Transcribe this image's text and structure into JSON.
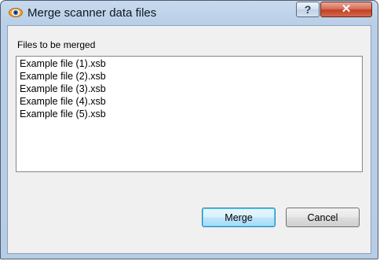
{
  "window": {
    "title": "Merge scanner data files",
    "help_label": "?",
    "close_label": "✕"
  },
  "dialog": {
    "files_label": "Files to be merged",
    "files": [
      "Example file (1).xsb",
      "Example file (2).xsb",
      "Example file (3).xsb",
      "Example file (4).xsb",
      "Example file (5).xsb"
    ],
    "merge_label": "Merge",
    "cancel_label": "Cancel"
  },
  "icons": {
    "app": "app-eye-icon",
    "help": "help-icon",
    "close": "close-icon"
  },
  "colors": {
    "titlebar": "#b9cfe7",
    "close_button": "#c34026",
    "default_button_border": "#3c7fb1"
  }
}
